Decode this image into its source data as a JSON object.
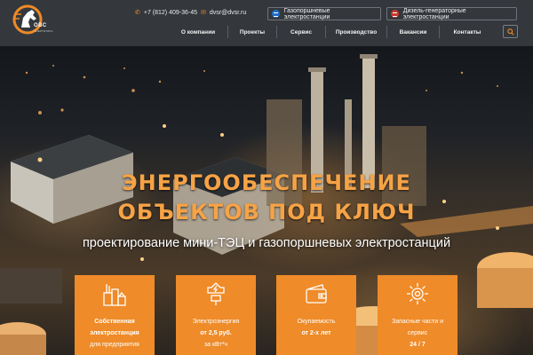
{
  "header": {
    "logo_text": "ОВС",
    "logo_sub": "ЭНЕРГЕТИКА",
    "phone": "+7 (812) 409-36-45",
    "email": "dvsr@dvsr.ru",
    "pills": [
      "Газопоршневые электростанции",
      "Дизель-генераторные электростанции"
    ],
    "nav": [
      "О компании",
      "Проекты",
      "Сервис",
      "Производство",
      "Вакансии",
      "Контакты"
    ],
    "colors": {
      "bg": "#34383d",
      "accent": "#f08a24"
    }
  },
  "hero": {
    "headline_line1": "ЭНЕРГООБЕСПЕЧЕНИЕ",
    "headline_line2": "ОБЪЕКТОВ ПОД КЛЮЧ",
    "subtitle": "проектирование мини-ТЭЦ и газопоршневых электростанций"
  },
  "cards": [
    {
      "icon": "power-plant-icon",
      "line1": "Собственная",
      "line2": "электростанция",
      "line3": "для предприятия"
    },
    {
      "icon": "energy-plug-icon",
      "line1": "Электроэнергия",
      "line2": "от 2,5 руб.",
      "line3": "за кВт*ч"
    },
    {
      "icon": "wallet-icon",
      "line1": "Окупаемость",
      "line2": "от 2-х лет"
    },
    {
      "icon": "gear-icon",
      "line1": "Запасные части и",
      "line2": "сервис",
      "line3": "24 / 7"
    }
  ],
  "colors": {
    "card": "#ef8b28",
    "headline": "#f6a346"
  }
}
